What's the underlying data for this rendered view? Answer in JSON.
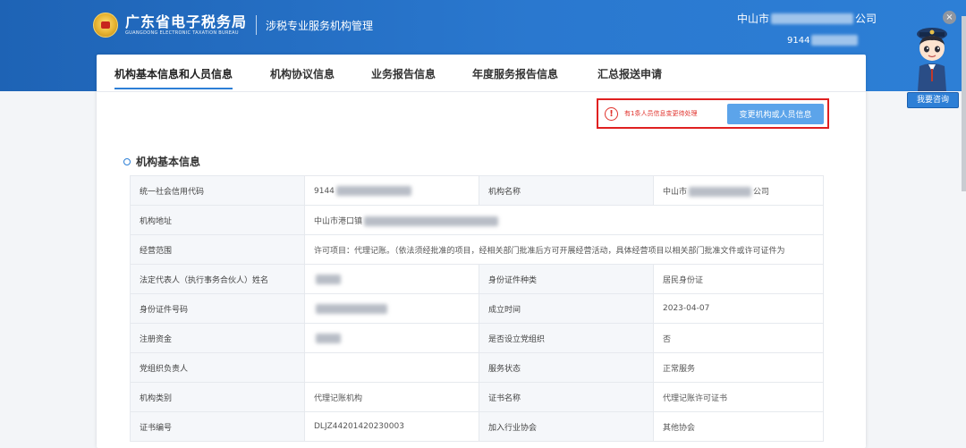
{
  "header": {
    "logo_cn": "广东省电子税务局",
    "logo_en": "GUANGDONG ELECTRONIC TAXATION BUREAU",
    "subtitle": "涉税专业服务机构管理",
    "company_prefix": "中山市",
    "company_suffix": "公司",
    "tax_id_prefix": "9144"
  },
  "tabs": [
    {
      "label": "机构基本信息和人员信息",
      "active": true
    },
    {
      "label": "机构协议信息"
    },
    {
      "label": "业务报告信息"
    },
    {
      "label": "年度服务报告信息"
    },
    {
      "label": "汇总报送申请"
    }
  ],
  "alert": {
    "text": "有1条人员信息变更待处理",
    "button": "变更机构或人员信息"
  },
  "section": {
    "title": "机构基本信息"
  },
  "table": {
    "r1": {
      "l1": "统一社会信用代码",
      "v1": "9144",
      "l2": "机构名称",
      "v2_prefix": "中山市",
      "v2_suffix": "公司"
    },
    "r2": {
      "l1": "机构地址",
      "v1": "中山市港口镇"
    },
    "r3": {
      "l1": "经营范围",
      "v1": "许可项目：代理记账。（依法须经批准的项目，经相关部门批准后方可开展经营活动，具体经营项目以相关部门批准文件或许可证件为"
    },
    "r4": {
      "l1": "法定代表人（执行事务合伙人）姓名",
      "l2": "身份证件种类",
      "v2": "居民身份证"
    },
    "r5": {
      "l1": "身份证件号码",
      "l2": "成立时间",
      "v2": "2023-04-07"
    },
    "r6": {
      "l1": "注册资金",
      "l2": "是否设立党组织",
      "v2": "否"
    },
    "r7": {
      "l1": "党组织负责人",
      "v1": "",
      "l2": "服务状态",
      "v2": "正常服务"
    },
    "r8": {
      "l1": "机构类别",
      "v1": "代理记账机构",
      "l2": "证书名称",
      "v2": "代理记账许可证书"
    },
    "r9": {
      "l1": "证书编号",
      "v1": "DLJZ44201420230003",
      "l2": "加入行业协会",
      "v2": "其他协会"
    }
  },
  "assistant": {
    "button": "我要咨询"
  },
  "colors": {
    "primary": "#2d7fd6",
    "alert": "#e0312b",
    "button": "#5ca4ea"
  }
}
